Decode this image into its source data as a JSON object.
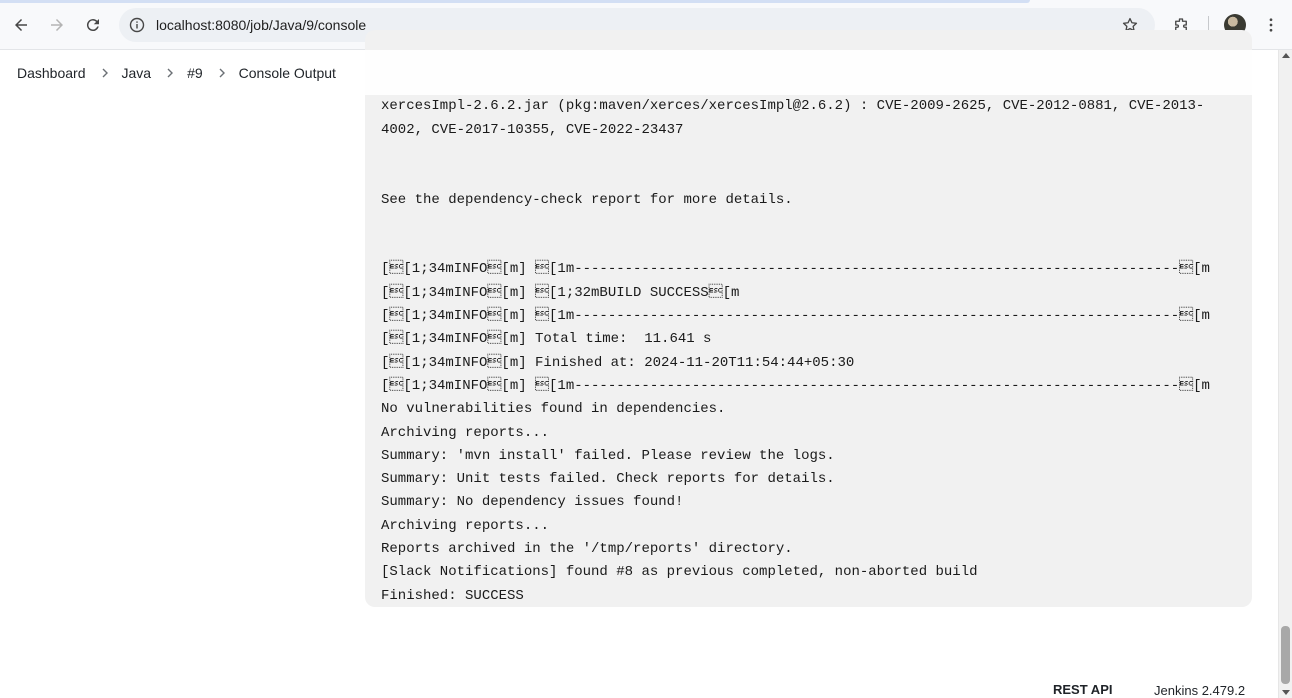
{
  "browser": {
    "url": "localhost:8080/job/Java/9/console",
    "icons": {
      "back": "back-arrow-icon",
      "forward": "forward-arrow-icon",
      "reload": "reload-icon",
      "info": "site-info-icon",
      "bookmark": "star-icon",
      "extensions": "puzzle-icon",
      "menu": "kebab-menu-icon"
    }
  },
  "breadcrumb": {
    "items": [
      "Dashboard",
      "Java",
      "#9",
      "Console Output"
    ]
  },
  "console": {
    "lines": [
      "xercesImpl-2.6.2.jar (pkg:maven/xerces/xercesImpl@2.6.2) : CVE-2009-2625, CVE-2012-0881, CVE-2013-",
      "4002, CVE-2017-10355, CVE-2022-23437",
      "",
      "",
      "See the dependency-check report for more details.",
      "",
      "",
      "[\u001b[1;34mINFO\u001b[m] \u001b[1m------------------------------------------------------------------------\u001b[m",
      "[\u001b[1;34mINFO\u001b[m] \u001b[1;32mBUILD SUCCESS\u001b[m",
      "[\u001b[1;34mINFO\u001b[m] \u001b[1m------------------------------------------------------------------------\u001b[m",
      "[\u001b[1;34mINFO\u001b[m] Total time:  11.641 s",
      "[\u001b[1;34mINFO\u001b[m] Finished at: 2024-11-20T11:54:44+05:30",
      "[\u001b[1;34mINFO\u001b[m] \u001b[1m------------------------------------------------------------------------\u001b[m",
      "No vulnerabilities found in dependencies.",
      "Archiving reports...",
      "Summary: 'mvn install' failed. Please review the logs.",
      "Summary: Unit tests failed. Check reports for details.",
      "Summary: No dependency issues found!",
      "Archiving reports...",
      "Reports archived in the '/tmp/reports' directory.",
      "[Slack Notifications] found #8 as previous completed, non-aborted build",
      "Finished: SUCCESS"
    ]
  },
  "footer": {
    "rest_api": "REST API",
    "version": "Jenkins 2.479.2"
  }
}
